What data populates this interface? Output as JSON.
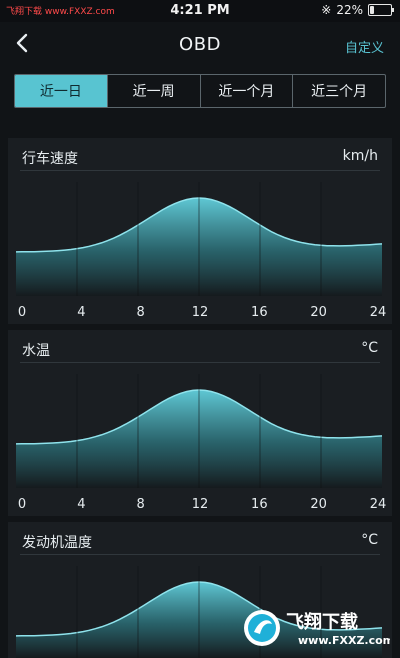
{
  "status_bar": {
    "watermark_left": "飞翔下载 www.FXXZ.com",
    "time": "4:21 PM",
    "battery": "22%",
    "battery_level": 0.22
  },
  "nav": {
    "title": "OBD",
    "right_action": "自定义"
  },
  "tabs": [
    {
      "label": "近一日",
      "active": true
    },
    {
      "label": "近一周",
      "active": false
    },
    {
      "label": "近一个月",
      "active": false
    },
    {
      "label": "近三个月",
      "active": false
    }
  ],
  "charts": [
    {
      "title": "行车速度",
      "unit": "km/h",
      "ticks": [
        "0",
        "4",
        "8",
        "12",
        "16",
        "20",
        "24"
      ],
      "color": "#5fc7d4"
    },
    {
      "title": "水温",
      "unit": "°C",
      "ticks": [
        "0",
        "4",
        "8",
        "12",
        "16",
        "20",
        "24"
      ],
      "color": "#5fc7d4"
    },
    {
      "title": "发动机温度",
      "unit": "°C",
      "ticks": [],
      "color": "#5fc7d4"
    }
  ],
  "watermark": {
    "brand": "飞翔下载",
    "url": "www.FXXZ.com"
  }
}
